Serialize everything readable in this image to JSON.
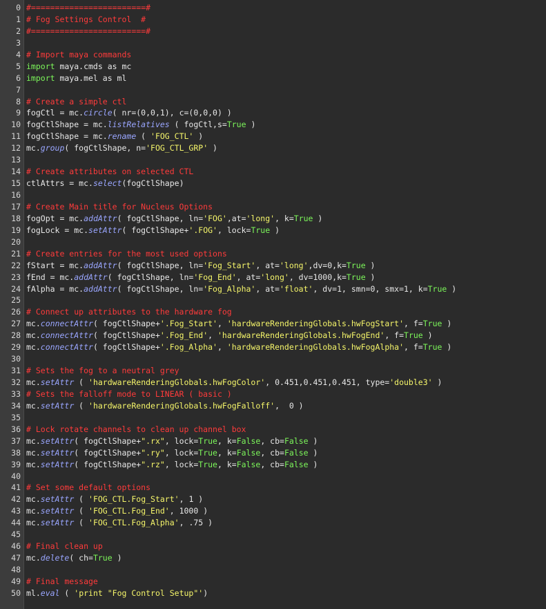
{
  "editor": {
    "language": "python",
    "colors": {
      "background": "#2b2b2b",
      "gutter": "#3c3c3c",
      "line_number": "#d7d7d7",
      "text": "#e8e8e8",
      "comment": "#ff3b3b",
      "keyword": "#7cf65a",
      "function": "#9aa6ff",
      "string": "#f5f56a"
    },
    "lines": [
      {
        "n": "0",
        "tokens": [
          {
            "t": "cmt",
            "v": "#========================#"
          }
        ]
      },
      {
        "n": "1",
        "tokens": [
          {
            "t": "cmt",
            "v": "# Fog Settings Control  #"
          }
        ]
      },
      {
        "n": "2",
        "tokens": [
          {
            "t": "cmt",
            "v": "#========================#"
          }
        ]
      },
      {
        "n": "3",
        "tokens": []
      },
      {
        "n": "4",
        "tokens": [
          {
            "t": "cmt",
            "v": "# Import maya commands"
          }
        ]
      },
      {
        "n": "5",
        "tokens": [
          {
            "t": "kw",
            "v": "import"
          },
          {
            "t": "plain",
            "v": " maya.cmds as mc"
          }
        ]
      },
      {
        "n": "6",
        "tokens": [
          {
            "t": "kw",
            "v": "import"
          },
          {
            "t": "plain",
            "v": " maya.mel as ml"
          }
        ]
      },
      {
        "n": "7",
        "tokens": []
      },
      {
        "n": "8",
        "tokens": [
          {
            "t": "cmt",
            "v": "# Create a simple ctl"
          }
        ]
      },
      {
        "n": "9",
        "tokens": [
          {
            "t": "plain",
            "v": "fogCtl = mc."
          },
          {
            "t": "fn",
            "v": "circle"
          },
          {
            "t": "plain",
            "v": "( nr=(0,0,1), c=(0,0,0) )"
          }
        ]
      },
      {
        "n": "10",
        "tokens": [
          {
            "t": "plain",
            "v": "fogCtlShape = mc."
          },
          {
            "t": "fn",
            "v": "listRelatives"
          },
          {
            "t": "plain",
            "v": " ( fogCtl,s="
          },
          {
            "t": "true",
            "v": "True"
          },
          {
            "t": "plain",
            "v": " )"
          }
        ]
      },
      {
        "n": "11",
        "tokens": [
          {
            "t": "plain",
            "v": "fogCtlShape = mc."
          },
          {
            "t": "fn",
            "v": "rename"
          },
          {
            "t": "plain",
            "v": " ( "
          },
          {
            "t": "str",
            "v": "'FOG_CTL'"
          },
          {
            "t": "plain",
            "v": " )"
          }
        ]
      },
      {
        "n": "12",
        "tokens": [
          {
            "t": "plain",
            "v": "mc."
          },
          {
            "t": "fn",
            "v": "group"
          },
          {
            "t": "plain",
            "v": "( fogCtlShape, n="
          },
          {
            "t": "str",
            "v": "'FOG_CTL_GRP'"
          },
          {
            "t": "plain",
            "v": " )"
          }
        ]
      },
      {
        "n": "13",
        "tokens": []
      },
      {
        "n": "14",
        "tokens": [
          {
            "t": "cmt",
            "v": "# Create attributes on selected CTL"
          }
        ]
      },
      {
        "n": "15",
        "tokens": [
          {
            "t": "plain",
            "v": "ctlAttrs = mc."
          },
          {
            "t": "fn",
            "v": "select"
          },
          {
            "t": "plain",
            "v": "(fogCtlShape)"
          }
        ]
      },
      {
        "n": "16",
        "tokens": []
      },
      {
        "n": "17",
        "tokens": [
          {
            "t": "cmt",
            "v": "# Create Main title for Nucleus Options"
          }
        ]
      },
      {
        "n": "18",
        "tokens": [
          {
            "t": "plain",
            "v": "fogOpt = mc."
          },
          {
            "t": "fn",
            "v": "addAttr"
          },
          {
            "t": "plain",
            "v": "( fogCtlShape, ln="
          },
          {
            "t": "str",
            "v": "'FOG'"
          },
          {
            "t": "plain",
            "v": ",at="
          },
          {
            "t": "str",
            "v": "'long'"
          },
          {
            "t": "plain",
            "v": ", k="
          },
          {
            "t": "true",
            "v": "True"
          },
          {
            "t": "plain",
            "v": " )"
          }
        ]
      },
      {
        "n": "19",
        "tokens": [
          {
            "t": "plain",
            "v": "fogLock = mc."
          },
          {
            "t": "fn",
            "v": "setAttr"
          },
          {
            "t": "plain",
            "v": "( fogCtlShape+"
          },
          {
            "t": "str",
            "v": "'.FOG'"
          },
          {
            "t": "plain",
            "v": ", lock="
          },
          {
            "t": "true",
            "v": "True"
          },
          {
            "t": "plain",
            "v": " )"
          }
        ]
      },
      {
        "n": "20",
        "tokens": []
      },
      {
        "n": "21",
        "tokens": [
          {
            "t": "cmt",
            "v": "# Create entries for the most used options"
          }
        ]
      },
      {
        "n": "22",
        "tokens": [
          {
            "t": "plain",
            "v": "fStart = mc."
          },
          {
            "t": "fn",
            "v": "addAttr"
          },
          {
            "t": "plain",
            "v": "( fogCtlShape, ln="
          },
          {
            "t": "str",
            "v": "'Fog_Start'"
          },
          {
            "t": "plain",
            "v": ", at="
          },
          {
            "t": "str",
            "v": "'long'"
          },
          {
            "t": "plain",
            "v": ",dv=0,k="
          },
          {
            "t": "true",
            "v": "True"
          },
          {
            "t": "plain",
            "v": " )"
          }
        ]
      },
      {
        "n": "23",
        "tokens": [
          {
            "t": "plain",
            "v": "fEnd = mc."
          },
          {
            "t": "fn",
            "v": "addAttr"
          },
          {
            "t": "plain",
            "v": "( fogCtlShape, ln="
          },
          {
            "t": "str",
            "v": "'Fog_End'"
          },
          {
            "t": "plain",
            "v": ", at="
          },
          {
            "t": "str",
            "v": "'long'"
          },
          {
            "t": "plain",
            "v": ", dv=1000,k="
          },
          {
            "t": "true",
            "v": "True"
          },
          {
            "t": "plain",
            "v": " )"
          }
        ]
      },
      {
        "n": "24",
        "tokens": [
          {
            "t": "plain",
            "v": "fAlpha = mc."
          },
          {
            "t": "fn",
            "v": "addAttr"
          },
          {
            "t": "plain",
            "v": "( fogCtlShape, ln="
          },
          {
            "t": "str",
            "v": "'Fog_Alpha'"
          },
          {
            "t": "plain",
            "v": ", at="
          },
          {
            "t": "str",
            "v": "'float'"
          },
          {
            "t": "plain",
            "v": ", dv=1, smn=0, smx=1, k="
          },
          {
            "t": "true",
            "v": "True"
          },
          {
            "t": "plain",
            "v": " )"
          }
        ]
      },
      {
        "n": "25",
        "tokens": []
      },
      {
        "n": "26",
        "tokens": [
          {
            "t": "cmt",
            "v": "# Connect up attributes to the hardware fog"
          }
        ]
      },
      {
        "n": "27",
        "tokens": [
          {
            "t": "plain",
            "v": "mc."
          },
          {
            "t": "fn",
            "v": "connectAttr"
          },
          {
            "t": "plain",
            "v": "( fogCtlShape+"
          },
          {
            "t": "str",
            "v": "'.Fog_Start'"
          },
          {
            "t": "plain",
            "v": ", "
          },
          {
            "t": "str",
            "v": "'hardwareRenderingGlobals.hwFogStart'"
          },
          {
            "t": "plain",
            "v": ", f="
          },
          {
            "t": "true",
            "v": "True"
          },
          {
            "t": "plain",
            "v": " )"
          }
        ]
      },
      {
        "n": "28",
        "tokens": [
          {
            "t": "plain",
            "v": "mc."
          },
          {
            "t": "fn",
            "v": "connectAttr"
          },
          {
            "t": "plain",
            "v": "( fogCtlShape+"
          },
          {
            "t": "str",
            "v": "'.Fog_End'"
          },
          {
            "t": "plain",
            "v": ", "
          },
          {
            "t": "str",
            "v": "'hardwareRenderingGlobals.hwFogEnd'"
          },
          {
            "t": "plain",
            "v": ", f="
          },
          {
            "t": "true",
            "v": "True"
          },
          {
            "t": "plain",
            "v": " )"
          }
        ]
      },
      {
        "n": "29",
        "tokens": [
          {
            "t": "plain",
            "v": "mc."
          },
          {
            "t": "fn",
            "v": "connectAttr"
          },
          {
            "t": "plain",
            "v": "( fogCtlShape+"
          },
          {
            "t": "str",
            "v": "'.Fog_Alpha'"
          },
          {
            "t": "plain",
            "v": ", "
          },
          {
            "t": "str",
            "v": "'hardwareRenderingGlobals.hwFogAlpha'"
          },
          {
            "t": "plain",
            "v": ", f="
          },
          {
            "t": "true",
            "v": "True"
          },
          {
            "t": "plain",
            "v": " )"
          }
        ]
      },
      {
        "n": "30",
        "tokens": []
      },
      {
        "n": "31",
        "tokens": [
          {
            "t": "cmt",
            "v": "# Sets the fog to a neutral grey"
          }
        ]
      },
      {
        "n": "32",
        "tokens": [
          {
            "t": "plain",
            "v": "mc."
          },
          {
            "t": "fn",
            "v": "setAttr"
          },
          {
            "t": "plain",
            "v": " ( "
          },
          {
            "t": "str",
            "v": "'hardwareRenderingGlobals.hwFogColor'"
          },
          {
            "t": "plain",
            "v": ", 0.451,0.451,0.451, type="
          },
          {
            "t": "str",
            "v": "'double3'"
          },
          {
            "t": "plain",
            "v": " )"
          }
        ]
      },
      {
        "n": "33",
        "tokens": [
          {
            "t": "cmt",
            "v": "# Sets the falloff mode to LINEAR ( basic )"
          }
        ]
      },
      {
        "n": "34",
        "tokens": [
          {
            "t": "plain",
            "v": "mc."
          },
          {
            "t": "fn",
            "v": "setAttr"
          },
          {
            "t": "plain",
            "v": " ( "
          },
          {
            "t": "str",
            "v": "'hardwareRenderingGlobals.hwFogFalloff'"
          },
          {
            "t": "plain",
            "v": ",  0 )"
          }
        ]
      },
      {
        "n": "35",
        "tokens": []
      },
      {
        "n": "36",
        "tokens": [
          {
            "t": "cmt",
            "v": "# Lock rotate channels to clean up channel box"
          }
        ]
      },
      {
        "n": "37",
        "tokens": [
          {
            "t": "plain",
            "v": "mc."
          },
          {
            "t": "fn",
            "v": "setAttr"
          },
          {
            "t": "plain",
            "v": "( fogCtlShape+"
          },
          {
            "t": "str",
            "v": "\".rx\""
          },
          {
            "t": "plain",
            "v": ", lock="
          },
          {
            "t": "true",
            "v": "True"
          },
          {
            "t": "plain",
            "v": ", k="
          },
          {
            "t": "false",
            "v": "False"
          },
          {
            "t": "plain",
            "v": ", cb="
          },
          {
            "t": "false",
            "v": "False"
          },
          {
            "t": "plain",
            "v": " )"
          }
        ]
      },
      {
        "n": "38",
        "tokens": [
          {
            "t": "plain",
            "v": "mc."
          },
          {
            "t": "fn",
            "v": "setAttr"
          },
          {
            "t": "plain",
            "v": "( fogCtlShape+"
          },
          {
            "t": "str",
            "v": "\".ry\""
          },
          {
            "t": "plain",
            "v": ", lock="
          },
          {
            "t": "true",
            "v": "True"
          },
          {
            "t": "plain",
            "v": ", k="
          },
          {
            "t": "false",
            "v": "False"
          },
          {
            "t": "plain",
            "v": ", cb="
          },
          {
            "t": "false",
            "v": "False"
          },
          {
            "t": "plain",
            "v": " )"
          }
        ]
      },
      {
        "n": "39",
        "tokens": [
          {
            "t": "plain",
            "v": "mc."
          },
          {
            "t": "fn",
            "v": "setAttr"
          },
          {
            "t": "plain",
            "v": "( fogCtlShape+"
          },
          {
            "t": "str",
            "v": "\".rz\""
          },
          {
            "t": "plain",
            "v": ", lock="
          },
          {
            "t": "true",
            "v": "True"
          },
          {
            "t": "plain",
            "v": ", k="
          },
          {
            "t": "false",
            "v": "False"
          },
          {
            "t": "plain",
            "v": ", cb="
          },
          {
            "t": "false",
            "v": "False"
          },
          {
            "t": "plain",
            "v": " )"
          }
        ]
      },
      {
        "n": "40",
        "tokens": []
      },
      {
        "n": "41",
        "tokens": [
          {
            "t": "cmt",
            "v": "# Set some default options"
          }
        ]
      },
      {
        "n": "42",
        "tokens": [
          {
            "t": "plain",
            "v": "mc."
          },
          {
            "t": "fn",
            "v": "setAttr"
          },
          {
            "t": "plain",
            "v": " ( "
          },
          {
            "t": "str",
            "v": "'FOG_CTL.Fog_Start'"
          },
          {
            "t": "plain",
            "v": ", 1 )"
          }
        ]
      },
      {
        "n": "43",
        "tokens": [
          {
            "t": "plain",
            "v": "mc."
          },
          {
            "t": "fn",
            "v": "setAttr"
          },
          {
            "t": "plain",
            "v": " ( "
          },
          {
            "t": "str",
            "v": "'FOG_CTL.Fog_End'"
          },
          {
            "t": "plain",
            "v": ", 1000 )"
          }
        ]
      },
      {
        "n": "44",
        "tokens": [
          {
            "t": "plain",
            "v": "mc."
          },
          {
            "t": "fn",
            "v": "setAttr"
          },
          {
            "t": "plain",
            "v": " ( "
          },
          {
            "t": "str",
            "v": "'FOG_CTL.Fog_Alpha'"
          },
          {
            "t": "plain",
            "v": ", .75 )"
          }
        ]
      },
      {
        "n": "45",
        "tokens": []
      },
      {
        "n": "46",
        "tokens": [
          {
            "t": "cmt",
            "v": "# Final clean up"
          }
        ]
      },
      {
        "n": "47",
        "tokens": [
          {
            "t": "plain",
            "v": "mc."
          },
          {
            "t": "fn",
            "v": "delete"
          },
          {
            "t": "plain",
            "v": "( ch="
          },
          {
            "t": "true",
            "v": "True"
          },
          {
            "t": "plain",
            "v": " )"
          }
        ]
      },
      {
        "n": "48",
        "tokens": []
      },
      {
        "n": "49",
        "tokens": [
          {
            "t": "cmt",
            "v": "# Final message"
          }
        ]
      },
      {
        "n": "50",
        "tokens": [
          {
            "t": "plain",
            "v": "ml."
          },
          {
            "t": "fn",
            "v": "eval"
          },
          {
            "t": "plain",
            "v": " ( "
          },
          {
            "t": "str",
            "v": "'print \"Fog Control Setup\"'"
          },
          {
            "t": "plain",
            "v": ")"
          }
        ]
      }
    ]
  }
}
